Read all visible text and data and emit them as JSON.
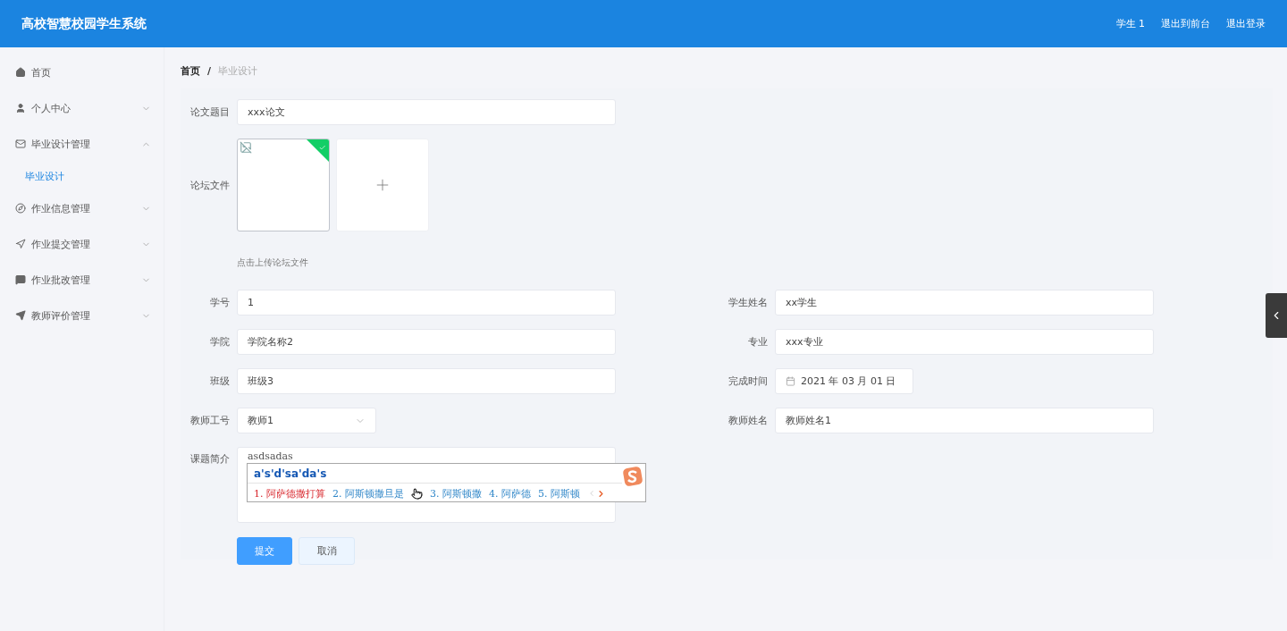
{
  "header": {
    "title": "高校智慧校园学生系统",
    "links": [
      "学生 1",
      "退出到前台",
      "退出登录"
    ]
  },
  "sidebar": {
    "items": [
      {
        "label": "首页",
        "kind": "link"
      },
      {
        "label": "个人中心",
        "kind": "menu",
        "expanded": false
      },
      {
        "label": "毕业设计管理",
        "kind": "menu",
        "expanded": true,
        "children": [
          {
            "label": "毕业设计",
            "selected": true
          }
        ]
      },
      {
        "label": "作业信息管理",
        "kind": "menu",
        "expanded": false
      },
      {
        "label": "作业提交管理",
        "kind": "menu",
        "expanded": false
      },
      {
        "label": "作业批改管理",
        "kind": "menu",
        "expanded": false
      },
      {
        "label": "教师评价管理",
        "kind": "menu",
        "expanded": false
      }
    ]
  },
  "breadcrumb": {
    "separator": "/",
    "items": [
      "首页",
      "毕业设计"
    ]
  },
  "form": {
    "title_field": {
      "label": "论文题目",
      "value": "xxx论文"
    },
    "upload": {
      "label": "论坛文件",
      "hint": "点击上传论坛文件",
      "files": [
        {
          "uploaded": true
        }
      ]
    },
    "rows": [
      [
        {
          "label": "学号",
          "value": "1",
          "kind": "input"
        },
        {
          "label": "学生姓名",
          "value": "xx学生",
          "kind": "input"
        }
      ],
      [
        {
          "label": "学院",
          "value": "学院名称2",
          "kind": "input"
        },
        {
          "label": "专业",
          "value": "xxx专业",
          "kind": "input"
        }
      ],
      [
        {
          "label": "班级",
          "value": "班级3",
          "kind": "input"
        },
        {
          "label": "完成时间",
          "value": "2021 年 03 月 01 日",
          "kind": "date"
        }
      ],
      [
        {
          "label": "教师工号",
          "value": "教师1",
          "kind": "select"
        },
        {
          "label": "教师姓名",
          "value": "教师姓名1",
          "kind": "input"
        }
      ]
    ],
    "summary": {
      "label": "课题简介",
      "value": "asdsadas"
    },
    "buttons": [
      {
        "label": "提交",
        "kind": "primary"
      },
      {
        "label": "取消",
        "kind": "default"
      }
    ]
  },
  "ime": {
    "composition": "a's'd'sa'da's",
    "candidates": [
      {
        "text": "1. 阿萨德撒打算",
        "selected": true
      },
      {
        "text": "2. 阿斯顿撒旦是",
        "selected": false
      },
      {
        "text": "3. 阿斯顿撒",
        "selected": false
      },
      {
        "text": "4. 阿萨德",
        "selected": false
      },
      {
        "text": "5. 阿斯顿",
        "selected": false
      }
    ]
  }
}
